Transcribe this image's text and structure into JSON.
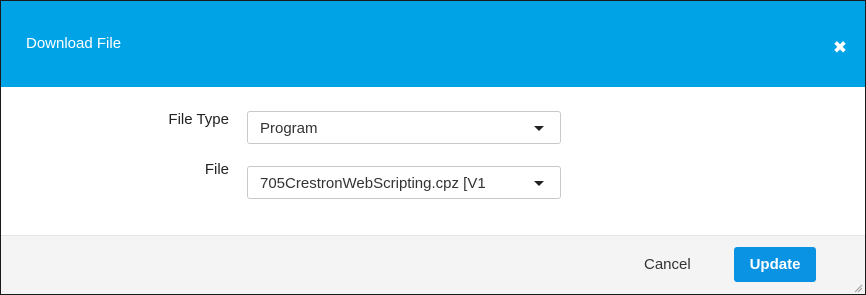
{
  "dialog": {
    "title": "Download File",
    "close_icon": "close-icon"
  },
  "form": {
    "file_type": {
      "label": "File Type",
      "selected": "Program"
    },
    "file": {
      "label": "File",
      "selected": "705CrestronWebScripting.cpz [V1"
    }
  },
  "footer": {
    "cancel_label": "Cancel",
    "update_label": "Update",
    "resize_icon": "resize-grip-icon"
  },
  "colors": {
    "header": "#00a3e6",
    "primary_button": "#0a93e3",
    "footer_bg": "#f4f4f4"
  }
}
